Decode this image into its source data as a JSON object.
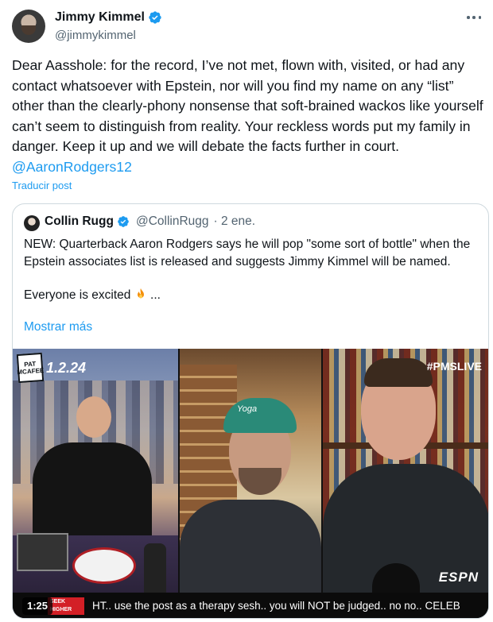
{
  "author": {
    "display_name": "Jimmy Kimmel",
    "handle": "@jimmykimmel"
  },
  "tweet": {
    "text_before_mention": "Dear Aasshole: for the record, I’ve not met, flown with, visited, or had any contact whatsoever with Epstein, nor will you find my name on any “list” other than the clearly-phony nonsense that soft-brained wackos like yourself can’t seem to distinguish from reality. Your reckless words put my family in danger. Keep it up and we will debate the facts further in court.",
    "mention": "@AaronRodgers12",
    "translate_label": "Traducir post"
  },
  "quote": {
    "display_name": "Collin Rugg",
    "handle": "@CollinRugg",
    "date": "· 2 ene.",
    "paragraph1": "NEW: Quarterback Aaron Rodgers says he will pop \"some sort of bottle\" when the Epstein associates list is released and suggests Jimmy Kimmel will be named.",
    "paragraph2": "Everyone is excited",
    "ellipsis": "...",
    "show_more_label": "Mostrar más"
  },
  "media": {
    "show_date": "1.2.24",
    "logo_text": "PAT MCAFEE",
    "cap_text": "Yoga",
    "hashtag": "#PMSLIVE",
    "network": "ESPN",
    "ticker_badge": "SEEK HIGHER",
    "ticker_text": "HT.. use the post as a therapy sesh.. you will NOT be judged.. no no.. CELEB",
    "video_time": "1:25"
  },
  "colors": {
    "link": "#1d9bf0",
    "text": "#0f1419",
    "secondary": "#536471",
    "border": "#cfd9de"
  },
  "icons": {
    "verified": "verified-badge-icon",
    "more": "more-options-icon",
    "fire": "fire-emoji-icon"
  }
}
